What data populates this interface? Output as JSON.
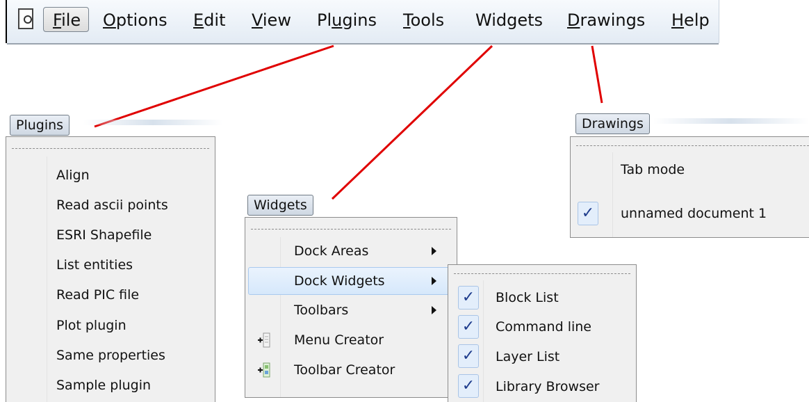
{
  "menubar": {
    "items": [
      {
        "pre": "",
        "u": "F",
        "post": "ile"
      },
      {
        "pre": "",
        "u": "O",
        "post": "ptions"
      },
      {
        "pre": "",
        "u": "E",
        "post": "dit"
      },
      {
        "pre": "",
        "u": "V",
        "post": "iew"
      },
      {
        "pre": "Pl",
        "u": "u",
        "post": "gins"
      },
      {
        "pre": "",
        "u": "T",
        "post": "ools"
      },
      {
        "pre": "",
        "u": "",
        "post": "Widgets"
      },
      {
        "pre": "",
        "u": "D",
        "post": "rawings"
      },
      {
        "pre": "",
        "u": "H",
        "post": "elp"
      }
    ]
  },
  "plugins_menu": {
    "title": "Plugins",
    "items": [
      "Align",
      "Read ascii points",
      "ESRI Shapefile",
      "List entities",
      "Read PIC file",
      "Plot plugin",
      "Same properties",
      "Sample plugin"
    ]
  },
  "widgets_menu": {
    "title": "Widgets",
    "items": [
      "Dock Areas",
      "Dock Widgets",
      "Toolbars",
      "Menu Creator",
      "Toolbar Creator"
    ]
  },
  "dock_widgets_submenu": {
    "check_glyph": "✓",
    "items": [
      "Block List",
      "Command line",
      "Layer List",
      "Library Browser"
    ]
  },
  "drawings_menu": {
    "title": "Drawings",
    "check_glyph": "✓",
    "items": [
      "Tab mode",
      "unnamed document 1"
    ]
  },
  "colors": {
    "callout_line": "#e00000",
    "highlight": "#d6e8fb",
    "check": "#1e3c8c"
  }
}
